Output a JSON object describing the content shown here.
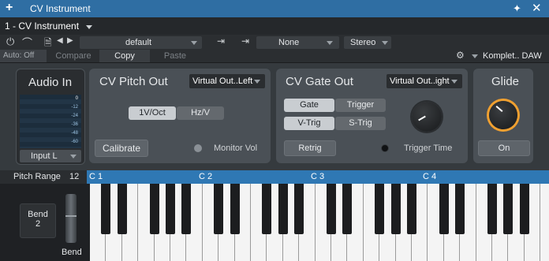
{
  "window": {
    "title": "CV Instrument",
    "add_icon": "plus-icon",
    "pin_icon": "pin-icon",
    "close_icon": "close-icon"
  },
  "instrument_tab": {
    "label": "1 - CV Instrument"
  },
  "toolbar": {
    "preset": "default",
    "routing": "None",
    "channel": "Stereo",
    "auto": "Auto: Off",
    "compare": "Compare",
    "copy": "Copy",
    "paste": "Paste",
    "device": "Komplet.. DAW"
  },
  "audio_in": {
    "title": "Audio In",
    "scale": [
      "0",
      "-12",
      "-24",
      "-36",
      "-48",
      "-60"
    ],
    "input": "Input L"
  },
  "cv_pitch": {
    "title": "CV Pitch Out",
    "output": "Virtual Out..Left",
    "mode_1": "1V/Oct",
    "mode_2": "Hz/V",
    "mode_selected": "1V/Oct",
    "calibrate": "Calibrate",
    "monitor": "Monitor Vol"
  },
  "cv_gate": {
    "title": "CV Gate Out",
    "output": "Virtual Out..ight",
    "gate": "Gate",
    "trigger": "Trigger",
    "vtrig": "V-Trig",
    "strig": "S-Trig",
    "retrig": "Retrig",
    "trigger_time": "Trigger Time"
  },
  "glide": {
    "title": "Glide",
    "state": "On",
    "accent": "#f0a030"
  },
  "keyboard": {
    "pitch_range_label": "Pitch Range",
    "pitch_range_value": "12",
    "octaves": [
      "C 1",
      "C 2",
      "C 3",
      "C 4"
    ],
    "bend_label": "Bend",
    "bend_value": "2",
    "bend_wheel_label": "Bend"
  }
}
